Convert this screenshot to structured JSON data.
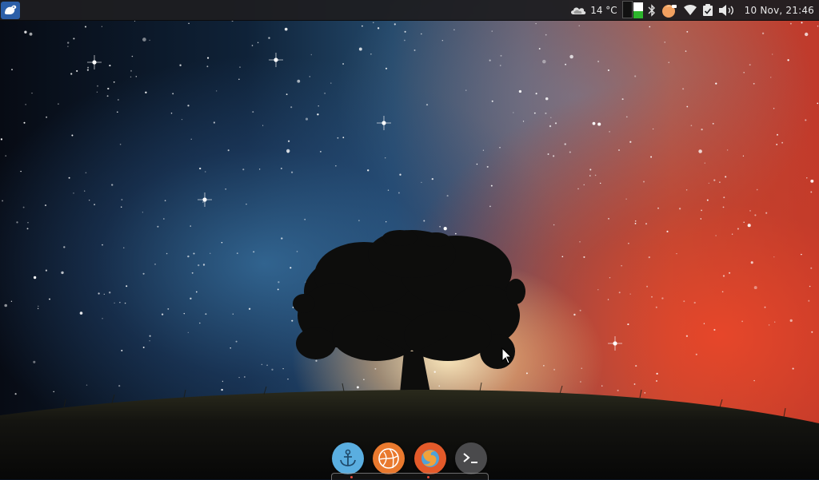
{
  "top_panel": {
    "weather": {
      "icon": "cloud-icon",
      "temperature": "14 °C"
    },
    "system_load": {
      "cpu_fraction": 0.0,
      "memory_fraction": 0.45
    },
    "tray_icons": [
      "bluetooth-icon",
      "power-manager-icon",
      "wifi-icon",
      "updates-icon",
      "volume-icon"
    ],
    "clock": "10 Nov, 21:46"
  },
  "dock": {
    "items": [
      {
        "name": "anchor-app",
        "icon": "anchor-icon",
        "color": "#5aaee0"
      },
      {
        "name": "web-browser",
        "icon": "globe-icon",
        "color": "#e9792e"
      },
      {
        "name": "firefox",
        "icon": "firefox-icon",
        "color": "#e35a2a"
      },
      {
        "name": "terminal",
        "icon": "terminal-icon",
        "color": "#4a4a4c"
      }
    ]
  },
  "colors": {
    "panel": "#1e1e21",
    "whisker": "#2c5fa8",
    "sky_left": "#0f2238",
    "sky_right": "#c0392b"
  }
}
